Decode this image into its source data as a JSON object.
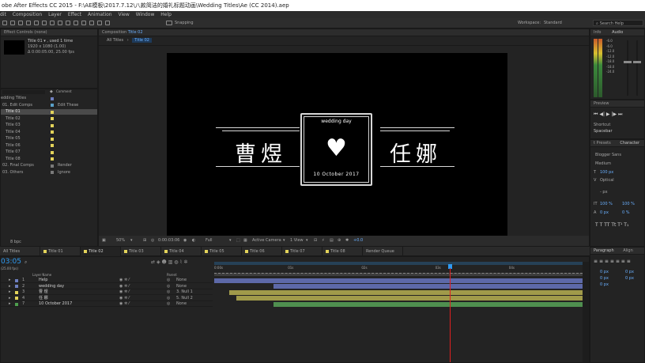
{
  "window": {
    "title": "obe After Effects CC 2015 - F:\\AE模板\\2017.7.12\\八款简洁的婚礼标题动画\\Wedding Titles\\Ae (CC 2014).aep"
  },
  "menu": [
    "dit",
    "Composition",
    "Layer",
    "Effect",
    "Animation",
    "View",
    "Window",
    "Help"
  ],
  "toolbar": {
    "snapping": "Snapping",
    "workspace_label": "Workspace:",
    "workspace_value": "Standard",
    "search": "Search Help"
  },
  "effect_controls": {
    "tab": "Effect Controls (none)"
  },
  "project": {
    "item_name": "Title 01 ▾ , used 1 time",
    "item_size": "1920 x 1080 (1.00)",
    "item_duration": "Δ 0:00:05:00, 25.00 fps",
    "col_comment": "Comment",
    "items": [
      {
        "name": "edding Titles",
        "color": "#6e7fbf",
        "comment": ""
      },
      {
        "name": "01. Edit Comps",
        "color": "#5aa0c8",
        "comment": "Edit These"
      },
      {
        "name": "Title 01",
        "color": "#e3d35a",
        "comment": "",
        "selected": true
      },
      {
        "name": "Title 02",
        "color": "#e3d35a",
        "comment": ""
      },
      {
        "name": "Title 03",
        "color": "#e3d35a",
        "comment": ""
      },
      {
        "name": "Title 04",
        "color": "#e3d35a",
        "comment": ""
      },
      {
        "name": "Title 05",
        "color": "#e3d35a",
        "comment": ""
      },
      {
        "name": "Title 06",
        "color": "#e3d35a",
        "comment": ""
      },
      {
        "name": "Title 07",
        "color": "#e3d35a",
        "comment": ""
      },
      {
        "name": "Title 08",
        "color": "#e3d35a",
        "comment": ""
      },
      {
        "name": "02. Final Comps",
        "color": "#7a7a7a",
        "comment": "Render"
      },
      {
        "name": "03. Others",
        "color": "#7a7a7a",
        "comment": "Ignore"
      }
    ],
    "bpc": "8 bpc"
  },
  "composition": {
    "tab_label": "Composition",
    "tab_name": "Title 02",
    "breadcrumbs": [
      "All Titles",
      "Title 02"
    ],
    "subtitle": "wedding day",
    "name_left": "曹煜",
    "name_right": "任娜",
    "date": "10 October 2017",
    "footer": {
      "zoom": "50%",
      "timecode": "0:00:03:06",
      "resolution": "Full",
      "camera": "Active Camera",
      "views": "1 View",
      "exposure": "+0.0"
    }
  },
  "info_panel": {
    "tab_info": "Info",
    "tab_audio": "Audio",
    "db_values": [
      "0.0",
      "-6.0",
      "-12.0",
      "-18.0",
      "-24.0"
    ],
    "db_labels": [
      "-6.0",
      "-6.0",
      "-12.0",
      "-12.0",
      "-18.0",
      "-18.0",
      "-24.0"
    ]
  },
  "preview": {
    "tab": "Preview",
    "shortcut_label": "Shortcut",
    "shortcut_value": "Spacebar"
  },
  "character": {
    "tab_effects": "t Presets",
    "tab": "Character",
    "font": "Blogger Sans",
    "style": "Medium",
    "size": "100 px",
    "kerning": "Optical",
    "leading": "- px",
    "tracking": "0",
    "vscale": "100 %",
    "hscale": "100 %",
    "baseline": "0 px",
    "tsume": "0 %"
  },
  "paragraph": {
    "tab": "Paragraph",
    "tab_align": "Align",
    "indent_values": [
      "0 px",
      "0 px",
      "0 px",
      "0 px",
      "0 px"
    ]
  },
  "timeline": {
    "tabs": [
      "All Titles",
      "Title 01",
      "Title 02",
      "Title 03",
      "Title 04",
      "Title 05",
      "Title 06",
      "Title 07",
      "Title 08",
      "Render Queue"
    ],
    "active_tab": "Title 02",
    "timecode": "03:05",
    "fps_note": "(25.00 fps)",
    "col_layer_name": "Layer Name",
    "col_parent": "Parent",
    "ruler": [
      "0:00s",
      "01s",
      "02s",
      "03s",
      "04s"
    ],
    "layers": [
      {
        "num": "1",
        "name": "Help",
        "parent": "None",
        "color": "#6e7fbf"
      },
      {
        "num": "2",
        "name": "wedding day",
        "parent": "None",
        "color": "#6e7fbf"
      },
      {
        "num": "3",
        "name": "曹 煜",
        "parent": "3. Null 1",
        "color": "#e3d35a"
      },
      {
        "num": "4",
        "name": "任 娜",
        "parent": "5. Null 2",
        "color": "#e3d35a"
      },
      {
        "num": "7",
        "name": "10 October 2017",
        "parent": "None",
        "color": "#4e9e4e"
      }
    ]
  },
  "colors": {
    "accent_blue": "#2e9bf2",
    "playhead": "#e02020",
    "bar_blue": "#5d69a8",
    "bar_yellow": "#a09a4a",
    "bar_green": "#4f8f4f"
  }
}
